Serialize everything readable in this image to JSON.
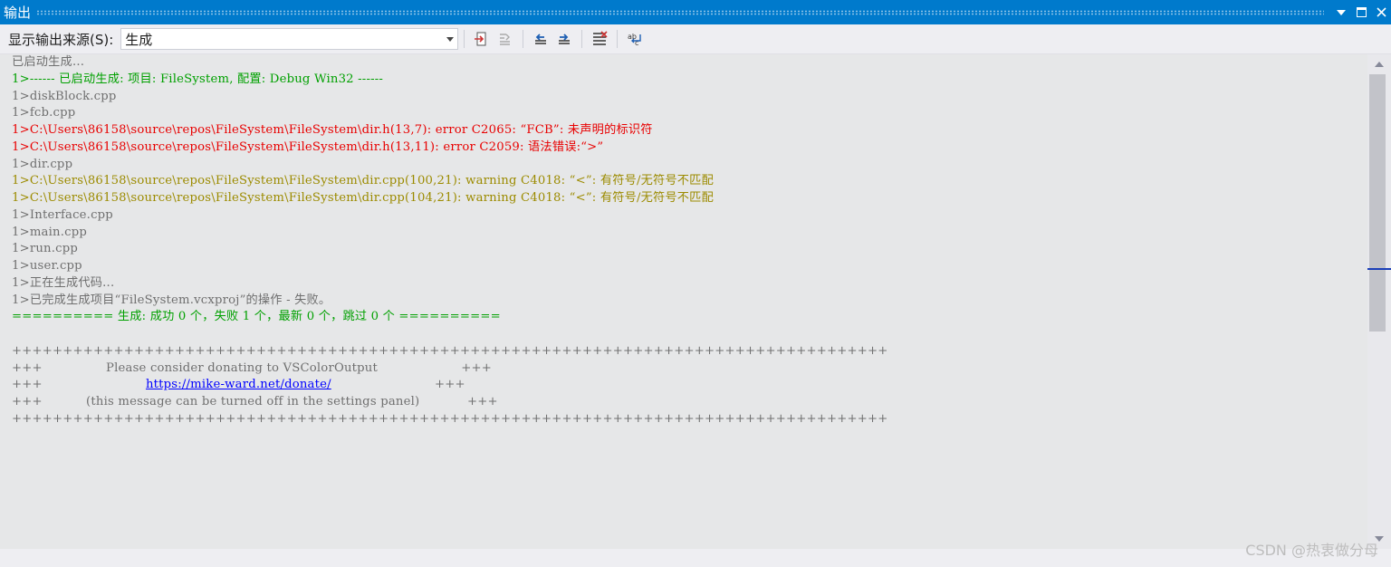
{
  "window": {
    "title": "输出"
  },
  "toolbar": {
    "source_label": "显示输出来源(S):",
    "source_value": "生成"
  },
  "output_lines": [
    {
      "text": "已启动生成…",
      "kind": "gray"
    },
    {
      "text": "1>------ 已启动生成: 项目: FileSystem, 配置: Debug Win32 ------",
      "kind": "green"
    },
    {
      "text": "1>diskBlock.cpp",
      "kind": "gray"
    },
    {
      "text": "1>fcb.cpp",
      "kind": "gray"
    },
    {
      "text": "1>C:\\Users\\86158\\source\\repos\\FileSystem\\FileSystem\\dir.h(13,7): error C2065: “FCB”: 未声明的标识符",
      "kind": "red"
    },
    {
      "text": "1>C:\\Users\\86158\\source\\repos\\FileSystem\\FileSystem\\dir.h(13,11): error C2059: 语法错误:“>”",
      "kind": "red"
    },
    {
      "text": "1>dir.cpp",
      "kind": "gray"
    },
    {
      "text": "1>C:\\Users\\86158\\source\\repos\\FileSystem\\FileSystem\\dir.cpp(100,21): warning C4018: “<”: 有符号/无符号不匹配",
      "kind": "olive"
    },
    {
      "text": "1>C:\\Users\\86158\\source\\repos\\FileSystem\\FileSystem\\dir.cpp(104,21): warning C4018: “<”: 有符号/无符号不匹配",
      "kind": "olive"
    },
    {
      "text": "1>Interface.cpp",
      "kind": "gray"
    },
    {
      "text": "1>main.cpp",
      "kind": "gray"
    },
    {
      "text": "1>run.cpp",
      "kind": "gray"
    },
    {
      "text": "1>user.cpp",
      "kind": "gray"
    },
    {
      "text": "1>正在生成代码...",
      "kind": "gray"
    },
    {
      "text": "1>已完成生成项目“FileSystem.vcxproj”的操作 - 失败。",
      "kind": "gray"
    },
    {
      "text": "========== 生成: 成功 0 个，失败 1 个，最新 0 个，跳过 0 个 ==========",
      "kind": "green"
    },
    {
      "text": "",
      "kind": "gray"
    },
    {
      "text": "++++++++++++++++++++++++++++++++++++++++++++++++++++++++++++++++++++++++++++++++++++++",
      "kind": "gray"
    },
    {
      "text": "+++                Please consider donating to VSColorOutput                     +++",
      "kind": "gray"
    },
    {
      "text_pre": "+++                          ",
      "link": "https://mike-ward.net/donate/",
      "text_post": "                          +++",
      "kind": "link"
    },
    {
      "text": "+++           (this message can be turned off in the settings panel)            +++",
      "kind": "gray"
    },
    {
      "text": "++++++++++++++++++++++++++++++++++++++++++++++++++++++++++++++++++++++++++++++++++++++",
      "kind": "gray"
    }
  ],
  "watermark": "CSDN @热衷做分母",
  "colors": {
    "titlebar": "#007acc",
    "green": "#00a000",
    "red": "#e80000",
    "olive": "#9c8b00",
    "gray": "#6f6f6f",
    "link": "#0000ff"
  },
  "icons": [
    "go-to-current-icon",
    "find-message-icon",
    "previous-message-icon",
    "next-message-icon",
    "clear-all-icon",
    "word-wrap-icon"
  ]
}
